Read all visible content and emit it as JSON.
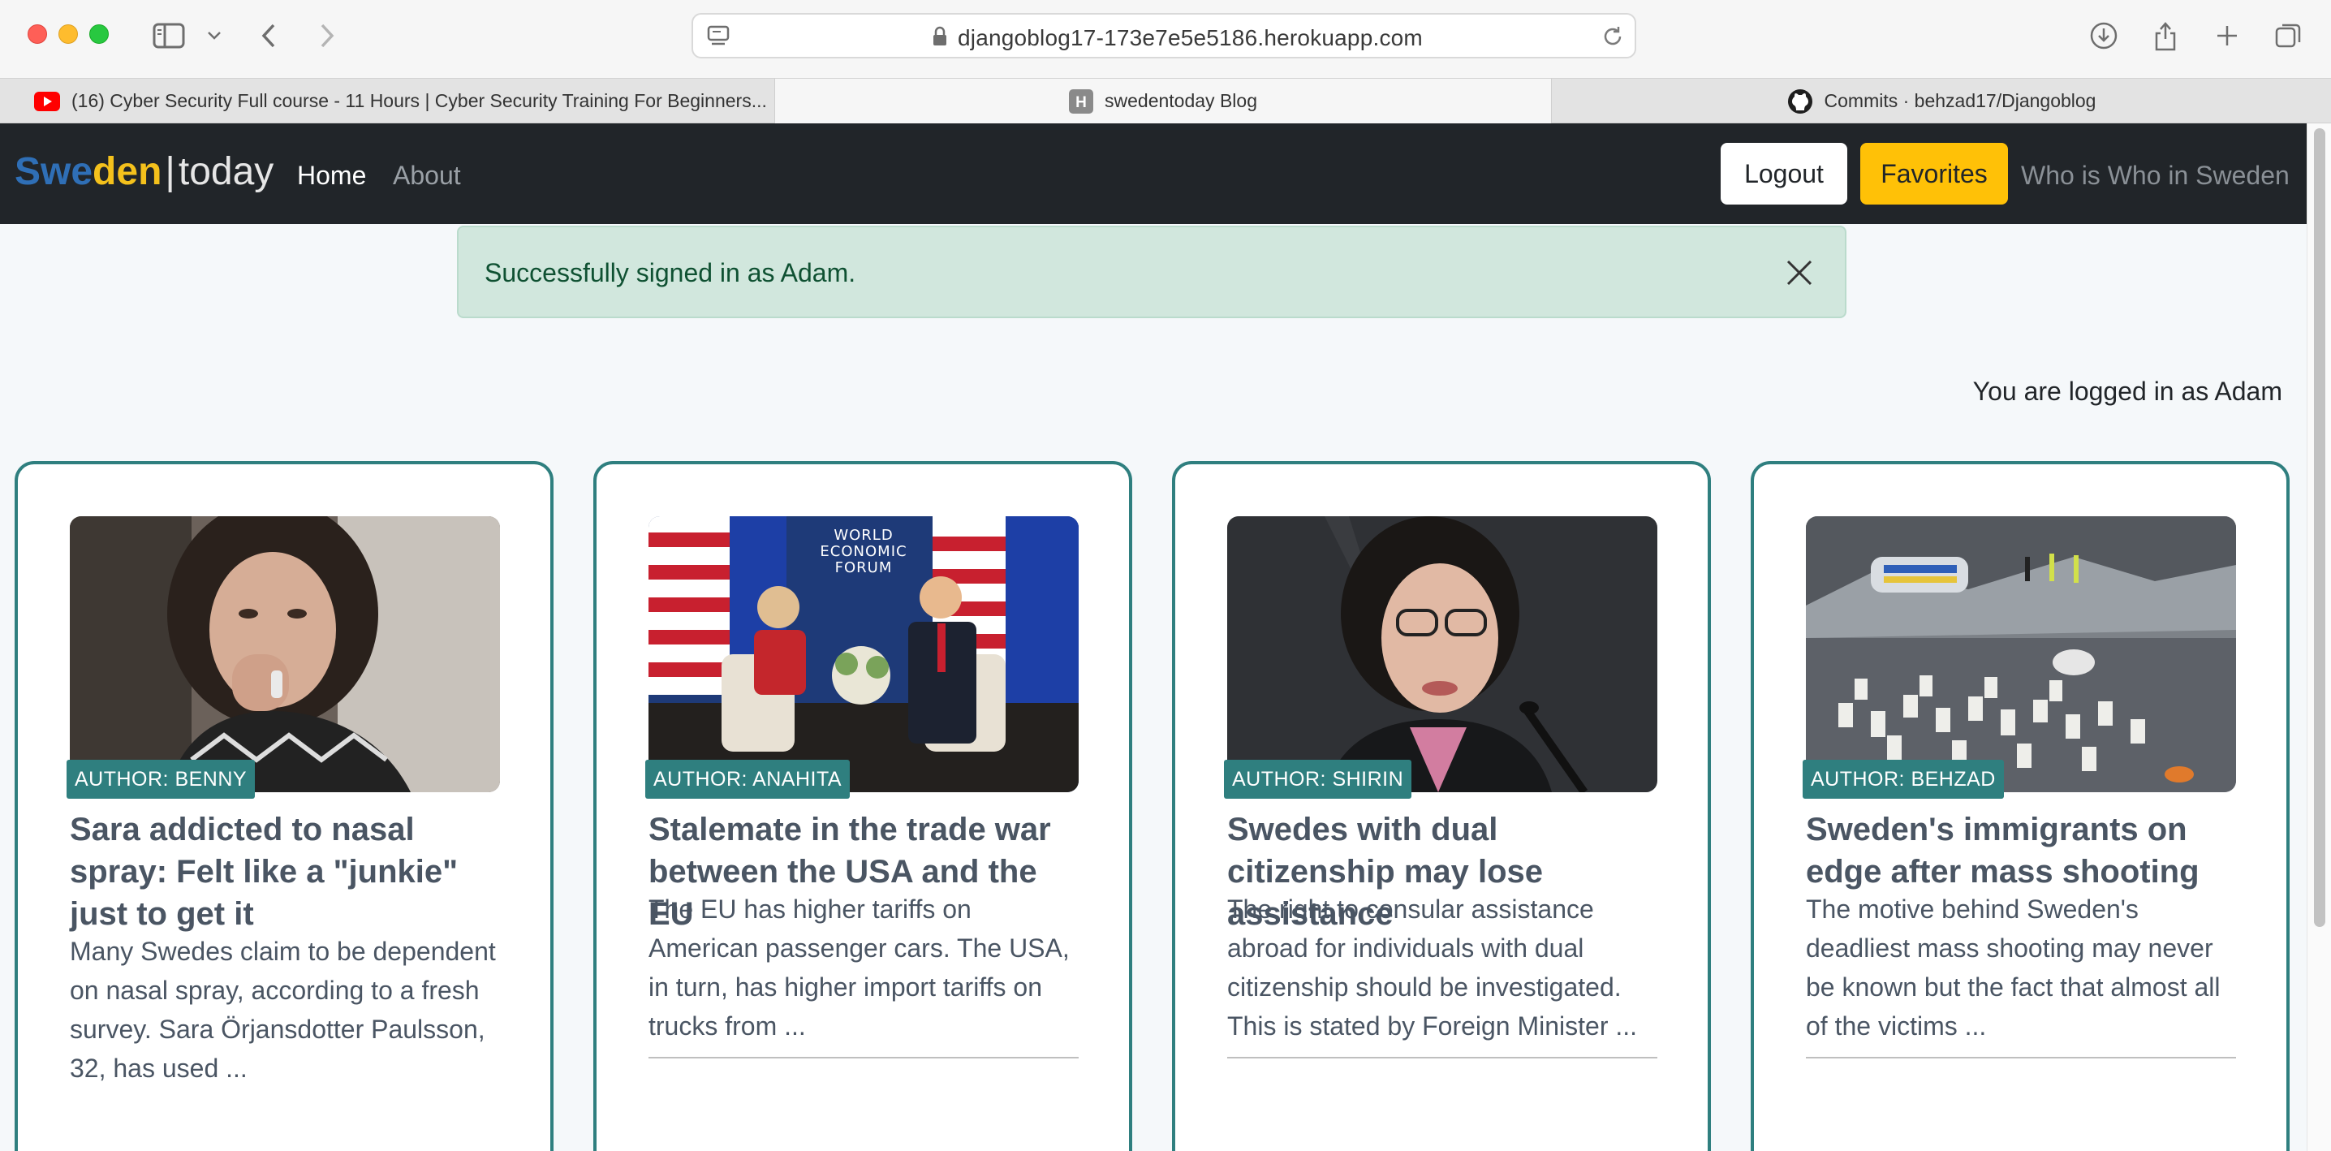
{
  "browser": {
    "url": "djangoblog17-173e7e5e5186.herokuapp.com",
    "tabs": [
      {
        "title": "(16) Cyber Security Full course - 11 Hours | Cyber Security Training For Beginners...",
        "favicon": "youtube-icon"
      },
      {
        "title": "swedentoday Blog",
        "favicon": "heroku-icon"
      },
      {
        "title": "Commits · behzad17/Djangoblog",
        "favicon": "github-icon"
      }
    ]
  },
  "nav": {
    "logo_swe": "Swe",
    "logo_den": "den",
    "logo_sep": "|",
    "logo_today": "today",
    "home": "Home",
    "about": "About",
    "logout": "Logout",
    "favorites": "Favorites",
    "who": "Who is Who in Sweden"
  },
  "alert": {
    "message": "Successfully signed in as Adam."
  },
  "status": {
    "logged_in": "You are logged in as Adam"
  },
  "posts": [
    {
      "author": "AUTHOR: BENNY",
      "title": "Sara addicted to nasal spray: Felt like a \"junkie\" just to get it",
      "excerpt": "Many Swedes claim to be dependent on nasal spray, according to a fresh survey. Sara Örjansdotter Paulsson, 32, has used ...",
      "image": "woman-with-nasal-spray-photo"
    },
    {
      "author": "AUTHOR: ANAHITA",
      "title": "Stalemate in the trade war between the USA and the EU",
      "excerpt": "The EU has higher tariffs on American passenger cars. The USA, in turn, has higher import tariffs on trucks from ...",
      "image": "world-economic-forum-meeting-photo",
      "image_caption": "WORLD ECONOMIC FORUM"
    },
    {
      "author": "AUTHOR: SHIRIN",
      "title": "Swedes with dual citizenship may lose assistance",
      "excerpt": "The right to consular assistance abroad for individuals with dual citizenship should be investigated. This is stated by Foreign Minister ...",
      "image": "foreign-minister-speaking-photo"
    },
    {
      "author": "AUTHOR: BEHZAD",
      "title": "Sweden's immigrants on edge after mass shooting",
      "excerpt": "The motive behind Sweden's deadliest mass shooting may never be known but the fact that almost all of the victims ...",
      "image": "memorial-candles-photo"
    }
  ]
}
